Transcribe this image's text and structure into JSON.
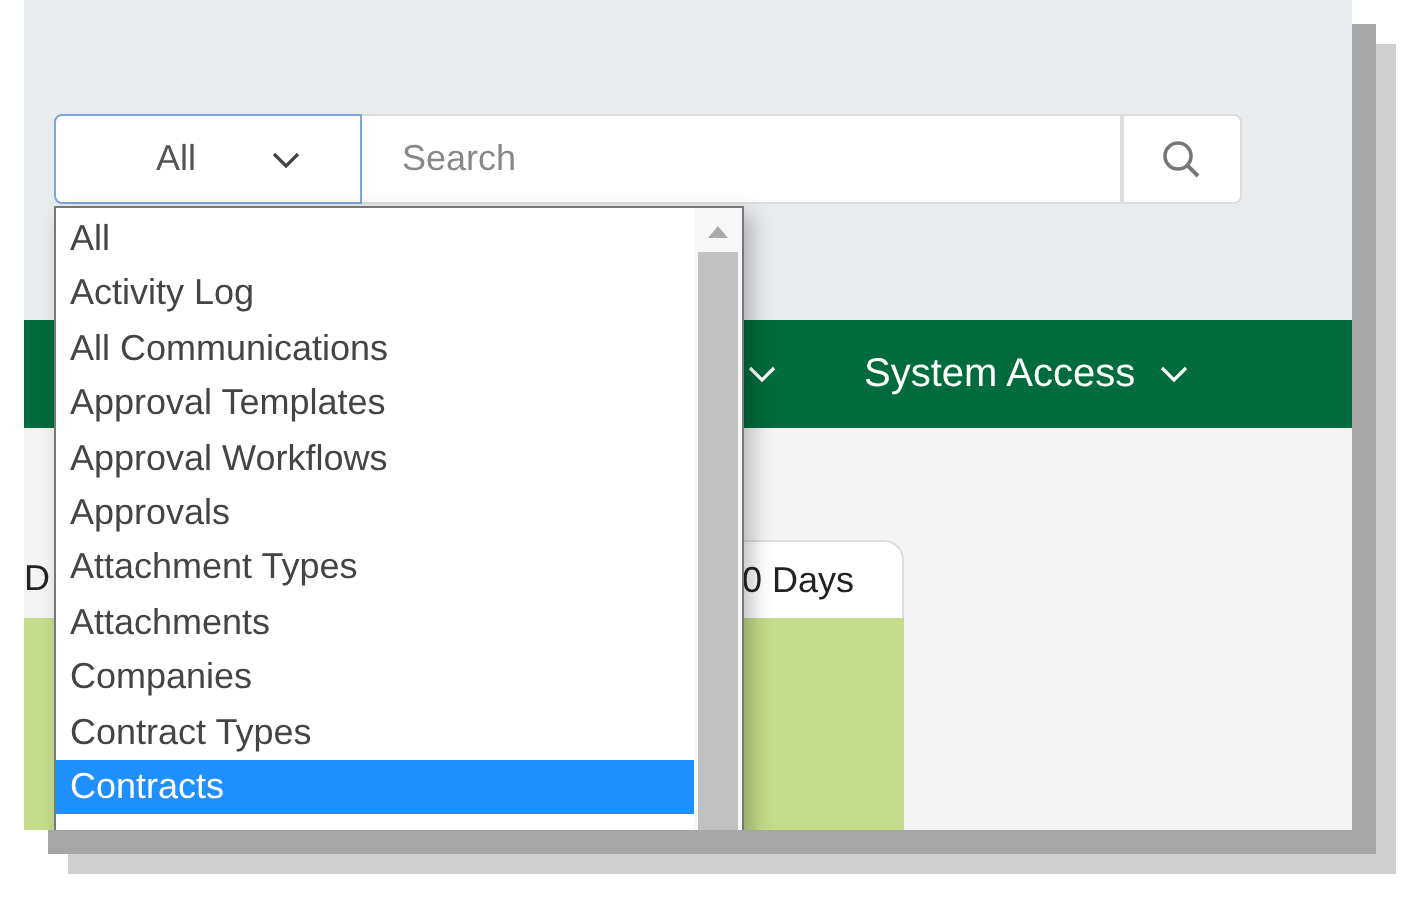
{
  "search_bar": {
    "category": "All",
    "placeholder": "Search"
  },
  "nav": {
    "items": [
      {
        "label": "System Access"
      }
    ]
  },
  "card": {
    "tabs": [
      {
        "label": "D",
        "selected": false
      },
      {
        "label": "0 Days",
        "selected": true
      }
    ]
  },
  "dropdown": {
    "options": [
      {
        "label": "All",
        "selected": false
      },
      {
        "label": "Activity Log",
        "selected": false
      },
      {
        "label": "All Communications",
        "selected": false
      },
      {
        "label": "Approval Templates",
        "selected": false
      },
      {
        "label": "Approval Workflows",
        "selected": false
      },
      {
        "label": "Approvals",
        "selected": false
      },
      {
        "label": "Attachment Types",
        "selected": false
      },
      {
        "label": "Attachments",
        "selected": false
      },
      {
        "label": "Companies",
        "selected": false
      },
      {
        "label": "Contract Types",
        "selected": false
      },
      {
        "label": "Contracts",
        "selected": true
      }
    ]
  }
}
